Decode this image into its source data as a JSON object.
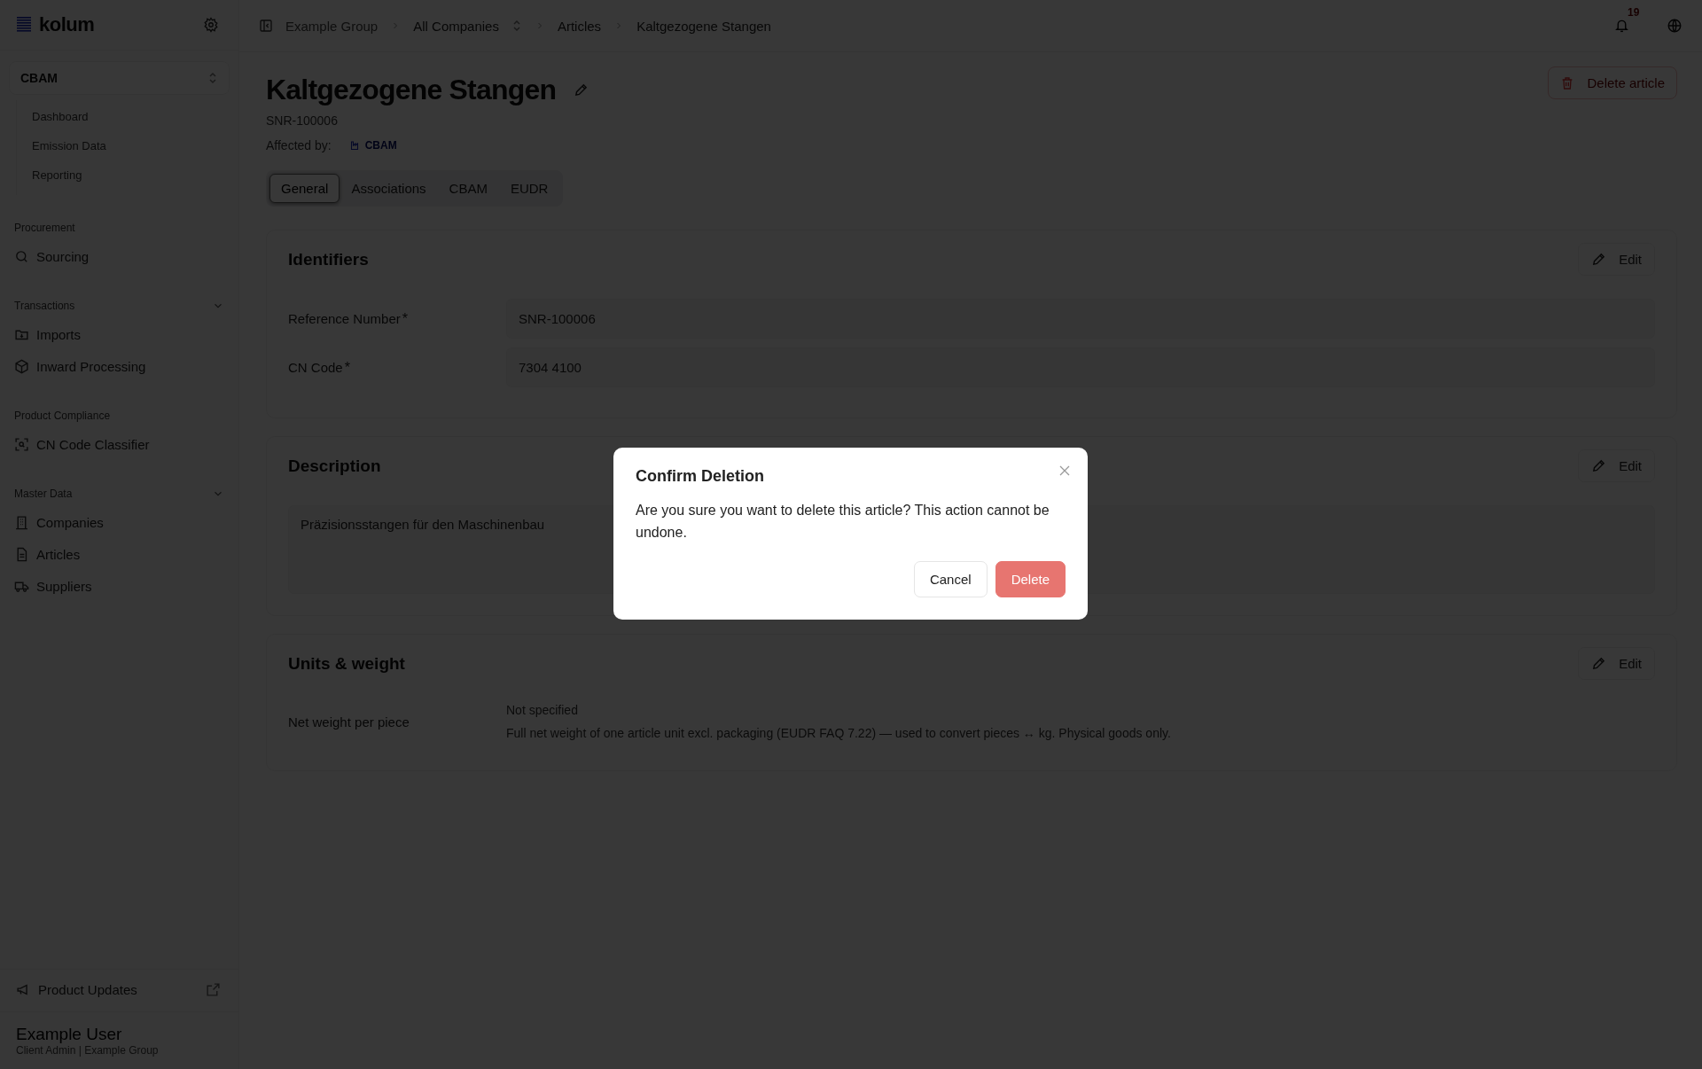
{
  "sidebar": {
    "logo": "kolum",
    "module_switcher": "CBAM",
    "module_items": [
      {
        "label": "Dashboard"
      },
      {
        "label": "Emission Data"
      },
      {
        "label": "Reporting"
      }
    ],
    "sections": [
      {
        "title": "Procurement",
        "items": [
          {
            "label": "Sourcing"
          }
        ]
      },
      {
        "title": "Transactions",
        "expanded": true,
        "items": [
          {
            "label": "Imports"
          },
          {
            "label": "Inward Processing"
          }
        ]
      },
      {
        "title": "Product Compliance",
        "items": [
          {
            "label": "CN Code Classifier"
          }
        ]
      },
      {
        "title": "Master Data",
        "expanded": true,
        "items": [
          {
            "label": "Companies"
          },
          {
            "label": "Articles"
          },
          {
            "label": "Suppliers"
          }
        ]
      }
    ],
    "footer_link": "Product Updates",
    "user": {
      "name": "Example User",
      "role": "Client Admin | Example Group"
    }
  },
  "breadcrumb": [
    {
      "label": "Example Group",
      "kind": "muted"
    },
    {
      "label": "All Companies",
      "kind": "switcher"
    },
    {
      "label": "Articles",
      "kind": "link"
    },
    {
      "label": "Kaltgezogene Stangen",
      "kind": "current"
    }
  ],
  "notifications": {
    "count": "19"
  },
  "article": {
    "title": "Kaltgezogene Stangen",
    "number": "SNR-100006",
    "affected_label": "Affected by:",
    "affected_badge": "CBAM",
    "delete_button": "Delete article"
  },
  "tabs": [
    {
      "label": "General",
      "selected": true
    },
    {
      "label": "Associations",
      "selected": false
    },
    {
      "label": "CBAM",
      "selected": false
    },
    {
      "label": "EUDR",
      "selected": false
    }
  ],
  "cards": [
    {
      "kind": "fields",
      "title": "Identifiers",
      "edit": "Edit",
      "fields": [
        {
          "label": "Reference Number",
          "mark": "*",
          "value": "SNR-100006"
        },
        {
          "label": "CN Code",
          "mark": "*",
          "value": "7304 4100"
        }
      ]
    },
    {
      "kind": "text",
      "title": "Description",
      "edit": "Edit",
      "value": "Präzisionsstangen für den Maschinenbau"
    },
    {
      "kind": "info",
      "title": "Units & weight",
      "edit": "Edit",
      "fields": [
        {
          "label": "Net weight per piece",
          "value": "Not specified",
          "hint": "Full net weight of one article unit excl. packaging (EUDR FAQ 7.22) — used to convert pieces ↔ kg. Physical goods only."
        }
      ]
    }
  ],
  "dialog": {
    "title": "Confirm Deletion",
    "message": "Are you sure you want to delete this article? This action cannot be undone.",
    "buttons": [
      {
        "label": "Cancel",
        "kind": "secondary"
      },
      {
        "label": "Delete",
        "kind": "danger"
      }
    ]
  }
}
